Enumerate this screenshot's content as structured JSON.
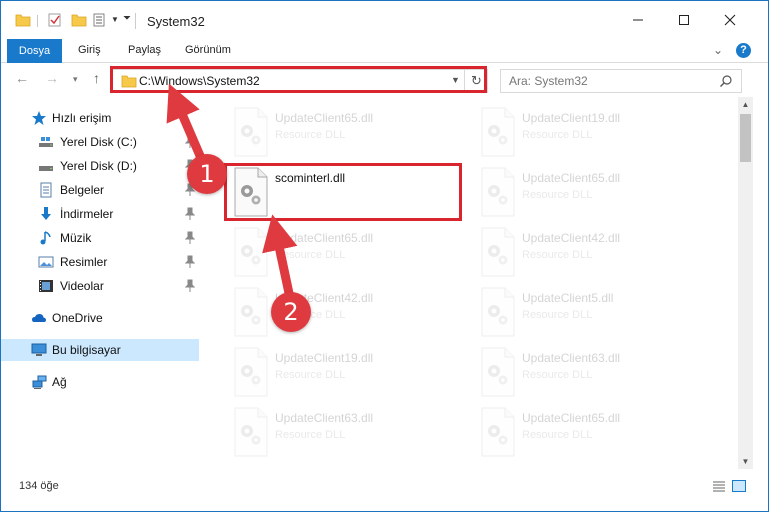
{
  "window": {
    "title": "System32",
    "controls": {
      "minimize": "minimize",
      "maximize": "maximize",
      "close": "close"
    }
  },
  "ribbon": {
    "file_tab": "Dosya",
    "tabs": [
      "Giriş",
      "Paylaş",
      "Görünüm"
    ]
  },
  "navigation": {
    "address": "C:\\Windows\\System32",
    "search_placeholder": "Ara: System32"
  },
  "sidebar": {
    "items": [
      {
        "label": "Hızlı erişim",
        "icon": "star-icon"
      },
      {
        "label": "Yerel Disk (C:)",
        "icon": "drive-icon",
        "pinned": true
      },
      {
        "label": "Yerel Disk (D:)",
        "icon": "drive-icon",
        "pinned": true
      },
      {
        "label": "Belgeler",
        "icon": "documents-icon",
        "pinned": true
      },
      {
        "label": "İndirmeler",
        "icon": "download-icon",
        "pinned": true
      },
      {
        "label": "Müzik",
        "icon": "music-icon",
        "pinned": true
      },
      {
        "label": "Resimler",
        "icon": "pictures-icon",
        "pinned": true
      },
      {
        "label": "Videolar",
        "icon": "videos-icon",
        "pinned": true
      },
      {
        "label": "OneDrive",
        "icon": "cloud-icon"
      },
      {
        "label": "Bu bilgisayar",
        "icon": "computer-icon",
        "selected": true
      },
      {
        "label": "Ağ",
        "icon": "network-icon"
      }
    ]
  },
  "files": [
    {
      "name": "UpdateClient65.dll",
      "type": "Resource DLL",
      "faded": true
    },
    {
      "name": "UpdateClient19.dll",
      "type": "Resource DLL",
      "faded": true
    },
    {
      "name": "UpdateClient65.dll",
      "type": "Resource DLL",
      "faded": true
    },
    {
      "name": "scominterl.dll",
      "type": "",
      "faded": false
    },
    {
      "name": "UpdateClient65.dll",
      "type": "Resource DLL",
      "faded": true
    },
    {
      "name": "UpdateClient65.dll",
      "type": "Resource DLL",
      "faded": true
    },
    {
      "name": "UpdateClient42.dll",
      "type": "Resource DLL",
      "faded": true
    },
    {
      "name": "UpdateClient42.dll",
      "type": "Resource DLL",
      "faded": true
    },
    {
      "name": "UpdateClient5.dll",
      "type": "Resource DLL",
      "faded": true
    },
    {
      "name": "UpdateClient19.dll",
      "type": "Resource DLL",
      "faded": true
    },
    {
      "name": "UpdateClient63.dll",
      "type": "Resource DLL",
      "faded": true
    },
    {
      "name": "UpdateClient63.dll",
      "type": "Resource DLL",
      "faded": true
    },
    {
      "name": "UpdateClient65.dll",
      "type": "Resource DLL",
      "faded": true
    }
  ],
  "status": {
    "item_count": "134 öğe"
  },
  "annotations": {
    "step1": "1",
    "step2": "2",
    "accent": "#d9252e"
  }
}
